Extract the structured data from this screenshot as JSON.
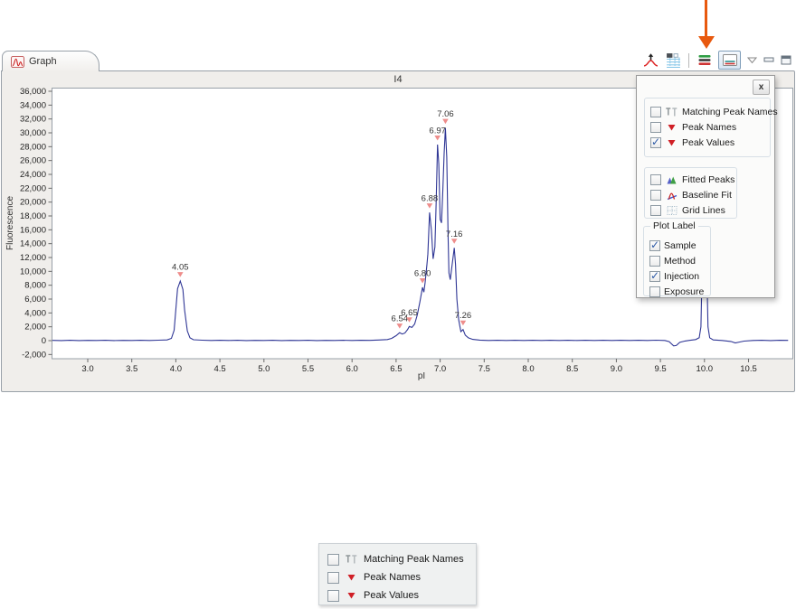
{
  "annotation_arrow": {
    "color": "#e8590e"
  },
  "view": {
    "tab_label": "Graph"
  },
  "chart_data": {
    "type": "line",
    "title": "I4",
    "xlabel": "pI",
    "ylabel": "Fluorescence",
    "xlim": [
      2.6,
      11.0
    ],
    "ylim": [
      -2000,
      36000
    ],
    "y_tick_step": 2000,
    "x_ticks": [
      3.0,
      3.5,
      4.0,
      4.5,
      5.0,
      5.5,
      6.0,
      6.5,
      7.0,
      7.5,
      8.0,
      8.5,
      9.0,
      9.5,
      10.0,
      10.5
    ],
    "grid": false,
    "legend": "none",
    "line_color": "#2f3695",
    "peak_marker_color": "#ee8d8b",
    "peaks": [
      {
        "label": "4.05",
        "pi": 4.05,
        "value": 8600
      },
      {
        "label": "6.54",
        "pi": 6.54,
        "value": 1150
      },
      {
        "label": "6.65",
        "pi": 6.65,
        "value": 2050
      },
      {
        "label": "6.80",
        "pi": 6.8,
        "value": 7700
      },
      {
        "label": "6.88",
        "pi": 6.88,
        "value": 18500
      },
      {
        "label": "6.97",
        "pi": 6.97,
        "value": 28300
      },
      {
        "label": "7.06",
        "pi": 7.06,
        "value": 30700
      },
      {
        "label": "7.16",
        "pi": 7.16,
        "value": 13400
      },
      {
        "label": "7.26",
        "pi": 7.26,
        "value": 1600
      }
    ],
    "trace": [
      [
        2.6,
        40
      ],
      [
        2.7,
        15
      ],
      [
        2.8,
        55
      ],
      [
        2.9,
        10
      ],
      [
        3.0,
        45
      ],
      [
        3.1,
        20
      ],
      [
        3.2,
        55
      ],
      [
        3.3,
        15
      ],
      [
        3.4,
        45
      ],
      [
        3.5,
        20
      ],
      [
        3.6,
        55
      ],
      [
        3.7,
        25
      ],
      [
        3.8,
        60
      ],
      [
        3.9,
        110
      ],
      [
        3.95,
        320
      ],
      [
        3.98,
        1500
      ],
      [
        4.0,
        4500
      ],
      [
        4.02,
        7500
      ],
      [
        4.05,
        8600
      ],
      [
        4.08,
        7400
      ],
      [
        4.1,
        4400
      ],
      [
        4.13,
        1400
      ],
      [
        4.16,
        400
      ],
      [
        4.2,
        130
      ],
      [
        4.3,
        60
      ],
      [
        4.4,
        25
      ],
      [
        4.5,
        55
      ],
      [
        4.6,
        20
      ],
      [
        4.7,
        50
      ],
      [
        4.8,
        18
      ],
      [
        4.9,
        45
      ],
      [
        5.0,
        22
      ],
      [
        5.1,
        50
      ],
      [
        5.2,
        18
      ],
      [
        5.3,
        45
      ],
      [
        5.4,
        22
      ],
      [
        5.5,
        50
      ],
      [
        5.6,
        18
      ],
      [
        5.7,
        45
      ],
      [
        5.8,
        22
      ],
      [
        5.9,
        50
      ],
      [
        6.0,
        28
      ],
      [
        6.1,
        58
      ],
      [
        6.2,
        40
      ],
      [
        6.3,
        85
      ],
      [
        6.4,
        160
      ],
      [
        6.45,
        320
      ],
      [
        6.5,
        720
      ],
      [
        6.54,
        1150
      ],
      [
        6.57,
        950
      ],
      [
        6.6,
        1100
      ],
      [
        6.63,
        1600
      ],
      [
        6.65,
        2050
      ],
      [
        6.68,
        1900
      ],
      [
        6.71,
        2400
      ],
      [
        6.74,
        3700
      ],
      [
        6.77,
        5600
      ],
      [
        6.8,
        7700
      ],
      [
        6.815,
        7000
      ],
      [
        6.83,
        8400
      ],
      [
        6.85,
        11000
      ],
      [
        6.86,
        12500
      ],
      [
        6.88,
        18500
      ],
      [
        6.9,
        16000
      ],
      [
        6.92,
        11800
      ],
      [
        6.94,
        13500
      ],
      [
        6.955,
        20000
      ],
      [
        6.97,
        28300
      ],
      [
        6.985,
        25500
      ],
      [
        7.0,
        17500
      ],
      [
        7.015,
        17000
      ],
      [
        7.03,
        21500
      ],
      [
        7.045,
        27000
      ],
      [
        7.06,
        30700
      ],
      [
        7.075,
        26500
      ],
      [
        7.09,
        15000
      ],
      [
        7.1,
        9800
      ],
      [
        7.115,
        8800
      ],
      [
        7.135,
        10800
      ],
      [
        7.16,
        13400
      ],
      [
        7.175,
        11000
      ],
      [
        7.19,
        6000
      ],
      [
        7.21,
        3000
      ],
      [
        7.235,
        1300
      ],
      [
        7.26,
        1600
      ],
      [
        7.285,
        800
      ],
      [
        7.32,
        400
      ],
      [
        7.37,
        180
      ],
      [
        7.45,
        80
      ],
      [
        7.55,
        30
      ],
      [
        7.65,
        55
      ],
      [
        7.75,
        20
      ],
      [
        7.85,
        50
      ],
      [
        7.95,
        22
      ],
      [
        8.05,
        52
      ],
      [
        8.15,
        25
      ],
      [
        8.25,
        55
      ],
      [
        8.35,
        22
      ],
      [
        8.45,
        50
      ],
      [
        8.55,
        28
      ],
      [
        8.65,
        55
      ],
      [
        8.75,
        22
      ],
      [
        8.85,
        50
      ],
      [
        8.95,
        28
      ],
      [
        9.05,
        55
      ],
      [
        9.15,
        30
      ],
      [
        9.25,
        58
      ],
      [
        9.35,
        32
      ],
      [
        9.45,
        60
      ],
      [
        9.55,
        20
      ],
      [
        9.6,
        -150
      ],
      [
        9.65,
        -750
      ],
      [
        9.68,
        -700
      ],
      [
        9.72,
        -250
      ],
      [
        9.78,
        -50
      ],
      [
        9.85,
        80
      ],
      [
        9.9,
        160
      ],
      [
        9.94,
        420
      ],
      [
        9.96,
        2000
      ],
      [
        9.98,
        15000
      ],
      [
        10.0,
        36000
      ],
      [
        10.02,
        15000
      ],
      [
        10.04,
        2000
      ],
      [
        10.06,
        420
      ],
      [
        10.1,
        110
      ],
      [
        10.2,
        30
      ],
      [
        10.3,
        -120
      ],
      [
        10.35,
        -330
      ],
      [
        10.4,
        -200
      ],
      [
        10.45,
        -60
      ],
      [
        10.55,
        25
      ],
      [
        10.65,
        48
      ],
      [
        10.75,
        15
      ],
      [
        10.85,
        50
      ],
      [
        10.95,
        35
      ]
    ]
  },
  "popup": {
    "close_label": "x",
    "groups": [
      {
        "items": [
          {
            "label": "Matching Peak Names",
            "icon": "matching-peak-names",
            "checked": false
          },
          {
            "label": "Peak Names",
            "icon": "peak-names",
            "checked": false
          },
          {
            "label": "Peak Values",
            "icon": "peak-values",
            "checked": true
          }
        ]
      },
      {
        "items": [
          {
            "label": "Fitted Peaks",
            "icon": "fitted-peaks",
            "checked": false
          },
          {
            "label": "Baseline Fit",
            "icon": "baseline-fit",
            "checked": false
          },
          {
            "label": "Grid Lines",
            "icon": "grid-lines",
            "checked": false
          }
        ]
      }
    ],
    "plot_label_group": {
      "title": "Plot Label",
      "items": [
        {
          "label": "Sample",
          "checked": true
        },
        {
          "label": "Method",
          "checked": false
        },
        {
          "label": "Injection",
          "checked": true
        },
        {
          "label": "Exposure",
          "checked": false
        }
      ]
    }
  },
  "float_panel": {
    "items": [
      {
        "label": "Matching Peak Names",
        "icon": "matching-peak-names",
        "checked": false
      },
      {
        "label": "Peak Names",
        "icon": "peak-names",
        "checked": false
      },
      {
        "label": "Peak Values",
        "icon": "peak-values",
        "checked": false
      }
    ]
  }
}
